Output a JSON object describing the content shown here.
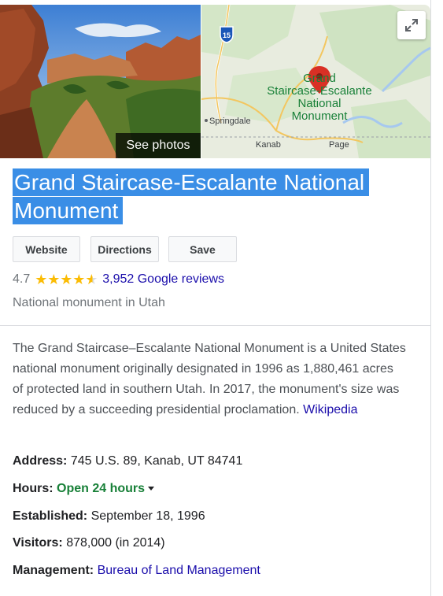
{
  "media": {
    "see_photos_label": "See photos",
    "map": {
      "pin_label_lines": [
        "Grand",
        "Staircase-Escalante",
        "National",
        "Monument"
      ],
      "route_badge": "15",
      "places": [
        "Springdale",
        "Kanab",
        "Page"
      ]
    },
    "expand_icon": "expand-icon"
  },
  "title": {
    "line1": "Grand Staircase-Escalante National",
    "line2": "Monument"
  },
  "actions": {
    "website": "Website",
    "directions": "Directions",
    "save": "Save"
  },
  "rating": {
    "value": "4.7",
    "stars": 4.7,
    "reviews": "3,952 Google reviews"
  },
  "subtitle": "National monument in Utah",
  "description": {
    "text": "The Grand Staircase–Escalante National Monument is a United States national monument originally designated in 1996 as 1,880,461 acres of protected land in southern Utah. In 2017, the monument's size was reduced by a succeeding presidential proclamation.",
    "source": "Wikipedia"
  },
  "facts": {
    "address": {
      "label": "Address:",
      "value": "745 U.S. 89, Kanab, UT 84741"
    },
    "hours": {
      "label": "Hours:",
      "value": "Open 24 hours"
    },
    "established": {
      "label": "Established:",
      "value": "September 18, 1996"
    },
    "visitors": {
      "label": "Visitors:",
      "value": "878,000 (in 2014)"
    },
    "management": {
      "label": "Management:",
      "value": "Bureau of Land Management"
    }
  },
  "colors": {
    "link": "#1a0dab",
    "open_green": "#188038",
    "star": "#fbbc04",
    "selection": "#3a8ee6"
  }
}
